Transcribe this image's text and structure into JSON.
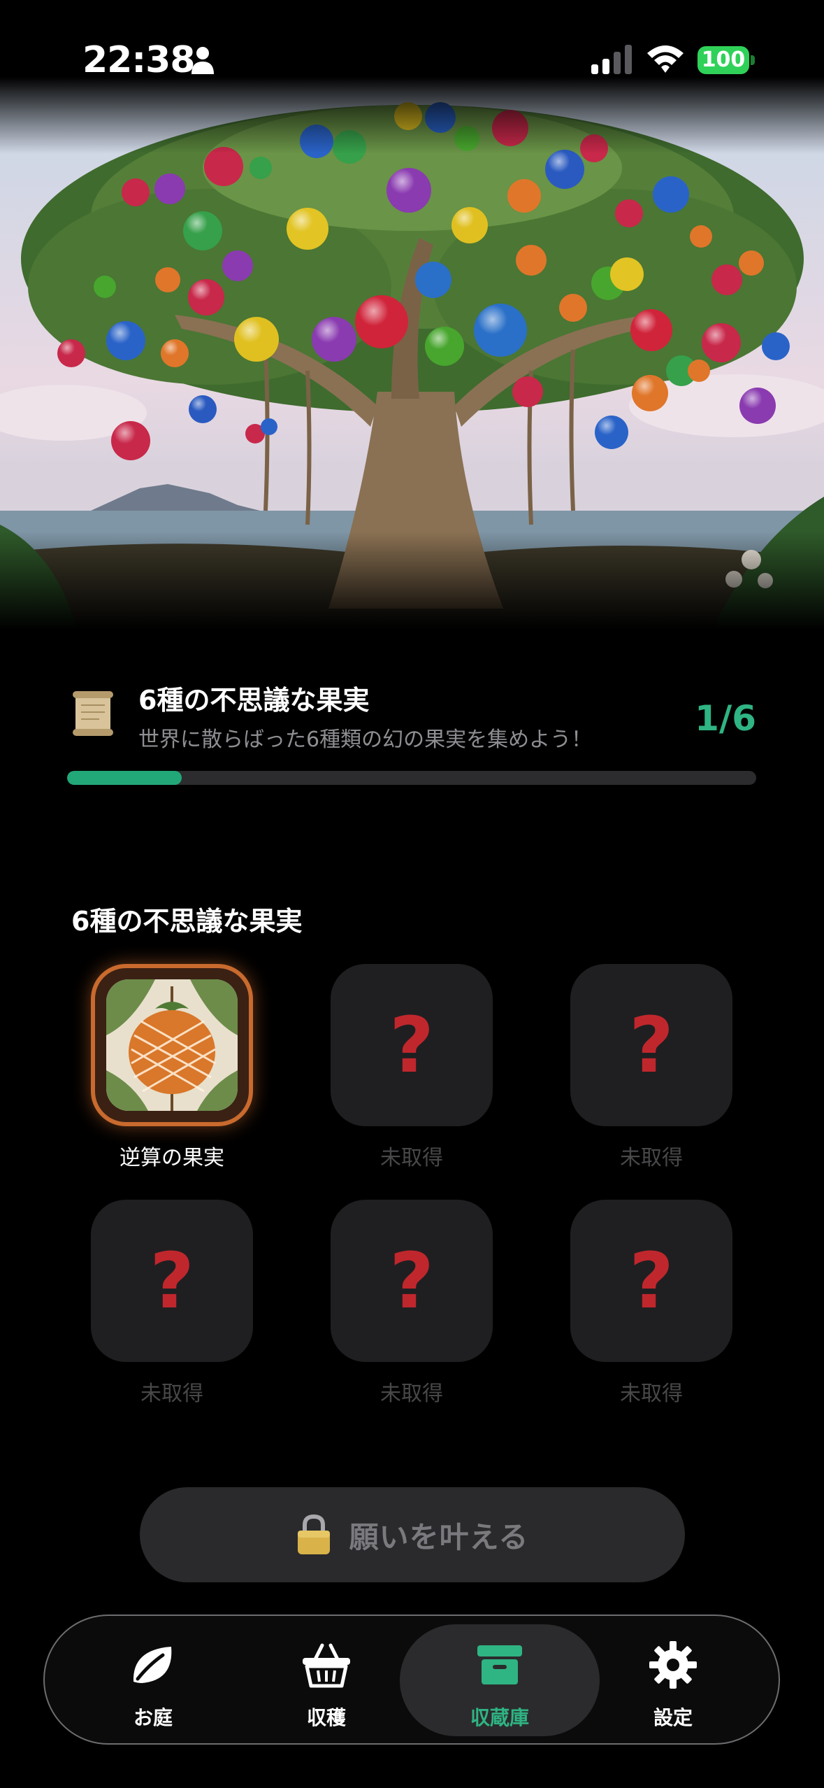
{
  "status_bar": {
    "time": "22:38",
    "battery": "100"
  },
  "mission": {
    "title": "6種の不思議な果実",
    "subtitle": "世界に散らばった6種類の幻の果実を集めよう！",
    "count": "1/6",
    "progress": 0.1667
  },
  "collection": {
    "title": "6種の不思議な果実",
    "items": [
      {
        "label": "逆算の果実",
        "owned": true
      },
      {
        "label": "未取得",
        "owned": false
      },
      {
        "label": "未取得",
        "owned": false
      },
      {
        "label": "未取得",
        "owned": false
      },
      {
        "label": "未取得",
        "owned": false
      },
      {
        "label": "未取得",
        "owned": false
      }
    ],
    "unknown_glyph": "?"
  },
  "wish_button": {
    "label": "願いを叶える",
    "locked": true
  },
  "tabbar": {
    "tabs": [
      {
        "label": "お庭",
        "icon": "leaf-icon"
      },
      {
        "label": "収穫",
        "icon": "basket-icon"
      },
      {
        "label": "収蔵庫",
        "icon": "archive-box-icon",
        "active": true
      },
      {
        "label": "設定",
        "icon": "gear-icon"
      }
    ]
  },
  "colors": {
    "accent": "#2fb483",
    "locked_question": "#c0272d",
    "owned_border": "#c96a2e"
  }
}
